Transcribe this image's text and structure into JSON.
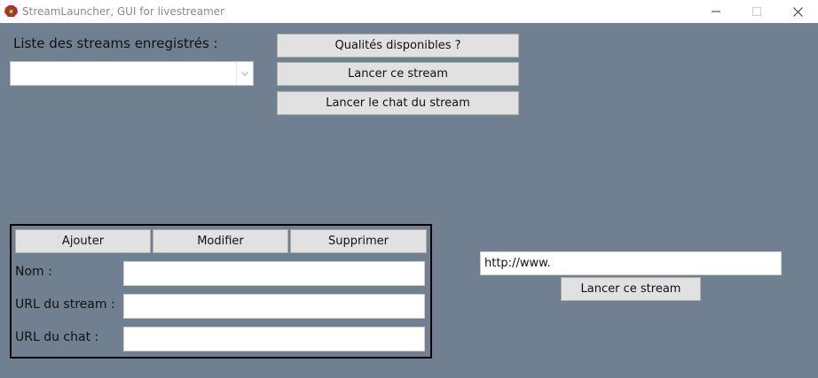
{
  "window": {
    "title": "StreamLauncher, GUI for livestreamer"
  },
  "colors": {
    "background": "#708090",
    "button": "#e1e1e1",
    "panel_border": "#000000"
  },
  "streams": {
    "list_label": "Liste des streams enregistrés :",
    "selected": ""
  },
  "actions": {
    "qualities": "Qualités disponibles ?",
    "launch_stream": "Lancer ce stream",
    "launch_chat": "Lancer le chat du stream"
  },
  "editor": {
    "add": "Ajouter",
    "modify": "Modifier",
    "delete": "Supprimer",
    "name_label": "Nom :",
    "url_label": "URL du stream :",
    "chat_label": "URL du chat :",
    "name_value": "",
    "url_value": "",
    "chat_value": ""
  },
  "quick_launch": {
    "url_value": "http://www.",
    "launch_label": "Lancer ce stream"
  },
  "icons": {
    "app": "app-logo-icon",
    "minimize": "minimize-icon",
    "maximize": "maximize-icon",
    "close": "close-icon",
    "dropdown": "chevron-down-icon"
  }
}
